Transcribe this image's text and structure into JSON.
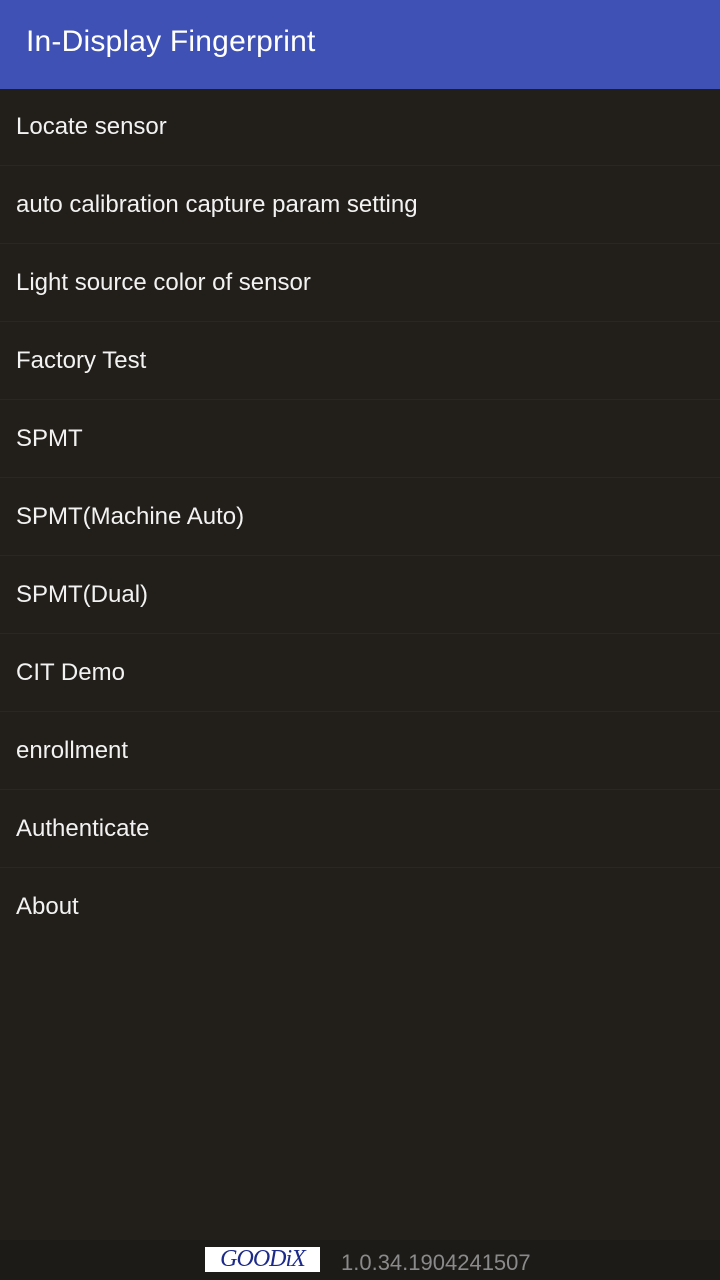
{
  "appbar": {
    "title": "In-Display Fingerprint"
  },
  "menu": {
    "items": [
      {
        "label": "Locate sensor"
      },
      {
        "label": "auto calibration capture param setting"
      },
      {
        "label": "Light source color of sensor"
      },
      {
        "label": "Factory Test"
      },
      {
        "label": "SPMT"
      },
      {
        "label": "SPMT(Machine Auto)"
      },
      {
        "label": "SPMT(Dual)"
      },
      {
        "label": "CIT Demo"
      },
      {
        "label": "enrollment"
      },
      {
        "label": "Authenticate"
      },
      {
        "label": "About"
      }
    ]
  },
  "footer": {
    "logo_text": "GOODiX",
    "version": "1.0.34.1904241507"
  },
  "colors": {
    "appbar": "#3f51b5",
    "background": "#221f1a",
    "text": "#f2f2f2",
    "version_text": "#8a8a8a"
  }
}
